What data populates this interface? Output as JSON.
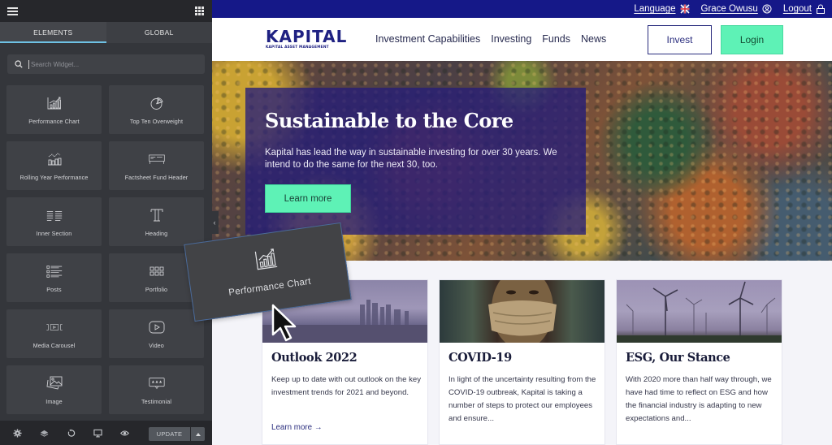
{
  "editor": {
    "tabs": [
      {
        "label": "ELEMENTS",
        "active": true
      },
      {
        "label": "GLOBAL",
        "active": false
      }
    ],
    "search": {
      "placeholder": "Search Widget...",
      "value": ""
    },
    "widgets": [
      {
        "label": "Performance Chart",
        "icon": "bar-chart-icon"
      },
      {
        "label": "Top Ten Overweight",
        "icon": "pie-chart-icon"
      },
      {
        "label": "Rolling Year Performance",
        "icon": "line-bar-chart-icon"
      },
      {
        "label": "Factsheet Fund Header",
        "icon": "header-icon"
      },
      {
        "label": "Inner Section",
        "icon": "columns-icon"
      },
      {
        "label": "Heading",
        "icon": "heading-icon"
      },
      {
        "label": "Posts",
        "icon": "posts-icon"
      },
      {
        "label": "Portfolio",
        "icon": "portfolio-icon"
      },
      {
        "label": "Media Carousel",
        "icon": "carousel-icon"
      },
      {
        "label": "Video",
        "icon": "video-icon"
      },
      {
        "label": "Image",
        "icon": "image-icon"
      },
      {
        "label": "Testimonial",
        "icon": "testimonial-icon"
      }
    ],
    "footer": {
      "icons": [
        "settings-icon",
        "layers-icon",
        "history-icon",
        "responsive-icon",
        "preview-icon"
      ],
      "update_label": "UPDATE"
    },
    "drag_ghost": {
      "label": "Performance Chart",
      "icon": "bar-chart-icon"
    }
  },
  "site": {
    "utility_bar": {
      "language_label": "Language",
      "user_name": "Grace Owusu",
      "logout_label": "Logout"
    },
    "logo": {
      "name": "KAPITAL",
      "tagline": "KAPITAL ASSET MANAGEMENT"
    },
    "nav": [
      {
        "label": "Investment Capabilities",
        "active": false
      },
      {
        "label": "Investing",
        "active": true
      },
      {
        "label": "Funds",
        "active": false
      },
      {
        "label": "News",
        "active": false
      }
    ],
    "invest_label": "Invest",
    "login_label": "Login",
    "hero": {
      "title": "Sustainable to the Core",
      "text": "Kapital has lead the way in sustainable investing for over 30 years. We intend to do the same for the next 30, too.",
      "button_label": "Learn more"
    },
    "cards": [
      {
        "title": "Outlook 2022",
        "text": "Keep up to date with out outlook on the key investment trends for 2021 and beyond.",
        "link": "Learn more →"
      },
      {
        "title": "COVID-19",
        "text": "In light of the uncertainty resulting from the COVID-19 outbreak, Kapital is taking a number of steps to protect our employees and ensure...",
        "link": ""
      },
      {
        "title": "ESG, Our Stance",
        "text": "With 2020 more than half way through, we have had time to reflect on ESG and how the financial industry is adapting to new expectations and...",
        "link": ""
      }
    ]
  },
  "colors": {
    "brand_navy": "#151888",
    "accent_mint": "#5ef2b6",
    "editor_bg": "#34363b",
    "editor_tab_indicator": "#6ec1e4"
  }
}
